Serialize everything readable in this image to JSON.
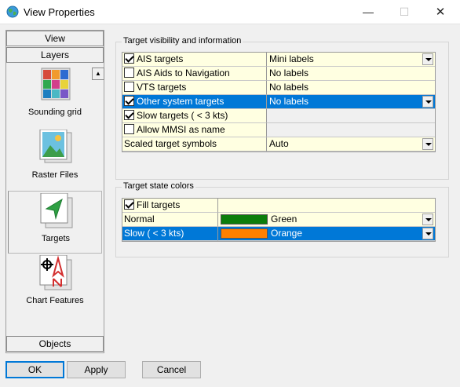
{
  "window": {
    "title": "View Properties",
    "minimize_glyph": "—",
    "maximize_glyph": "☐",
    "close_glyph": "✕"
  },
  "sidebar": {
    "top_headers": [
      "View",
      "Layers"
    ],
    "bottom_header": "Objects",
    "scroll_up_glyph": "▲",
    "items": [
      {
        "label": "Sounding grid",
        "icon": "sounding-grid-icon"
      },
      {
        "label": "Raster Files",
        "icon": "raster-image-icon"
      },
      {
        "label": "Targets",
        "icon": "target-arrow-icon",
        "selected": true
      },
      {
        "label": "Chart Features",
        "icon": "chart-features-icon"
      }
    ]
  },
  "visibility_group": {
    "legend": "Target visibility and information",
    "rows": [
      {
        "label": "AIS targets",
        "checkbox": true,
        "checked": true,
        "value": "Mini labels",
        "dropdown": true,
        "selected": false
      },
      {
        "label": "AIS Aids to Navigation",
        "checkbox": true,
        "checked": false,
        "value": "No labels",
        "dropdown": false,
        "selected": false
      },
      {
        "label": "VTS targets",
        "checkbox": true,
        "checked": false,
        "value": "No labels",
        "dropdown": false,
        "selected": false
      },
      {
        "label": "Other system targets",
        "checkbox": true,
        "checked": true,
        "value": "No labels",
        "dropdown": true,
        "selected": true
      },
      {
        "label": "Slow targets ( < 3 kts)",
        "checkbox": true,
        "checked": true,
        "value": "",
        "dropdown": false,
        "selected": false
      },
      {
        "label": "Allow MMSI as name",
        "checkbox": true,
        "checked": false,
        "value": "",
        "dropdown": false,
        "selected": false
      },
      {
        "label": "Scaled target symbols",
        "checkbox": false,
        "checked": false,
        "value": "Auto",
        "dropdown": true,
        "selected": false
      }
    ]
  },
  "colors_group": {
    "legend": "Target state colors",
    "fill_targets": {
      "label": "Fill targets",
      "checked": true
    },
    "rows": [
      {
        "label": "Normal",
        "color_name": "Green",
        "color_hex": "#0b7d0b",
        "selected": false
      },
      {
        "label": "Slow ( < 3 kts)",
        "color_name": "Orange",
        "color_hex": "#ff8000",
        "selected": true
      }
    ]
  },
  "buttons": {
    "ok": "OK",
    "apply": "Apply",
    "cancel": "Cancel"
  },
  "colors": {
    "selection": "#0078d7",
    "grid_background": "#ffffe1"
  }
}
